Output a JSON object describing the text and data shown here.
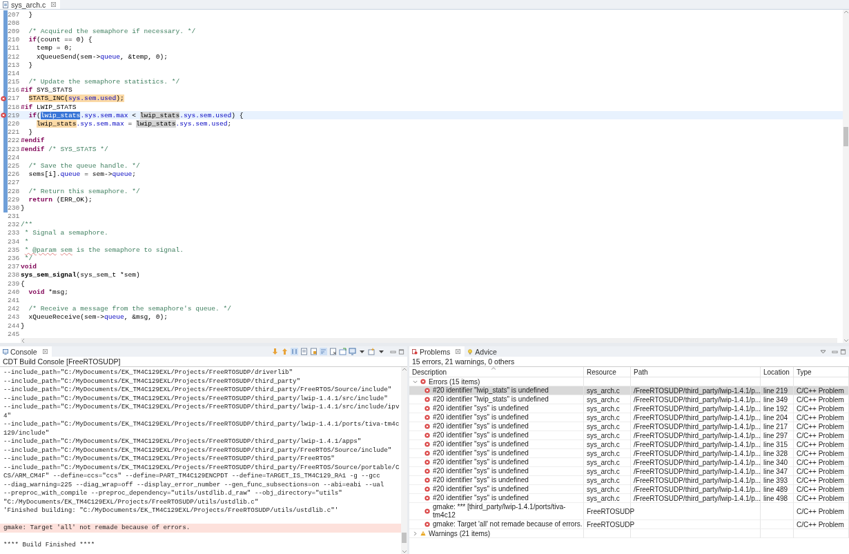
{
  "editor": {
    "tab": {
      "label": "sys_arch.c",
      "selected": true
    },
    "lines": [
      {
        "number": "207",
        "changed": true,
        "tokens": [
          {
            "kind": "plain",
            "text": "  }"
          }
        ]
      },
      {
        "number": "208",
        "changed": true
      },
      {
        "number": "209",
        "changed": true,
        "tokens": [
          {
            "kind": "comment",
            "text": "  /* Acquired the semaphore if necessary. */"
          }
        ]
      },
      {
        "number": "210",
        "changed": true,
        "tokens": [
          {
            "kind": "keyword",
            "text": "  if"
          },
          {
            "kind": "plain",
            "text": "(count == 0) {"
          }
        ]
      },
      {
        "number": "211",
        "changed": true,
        "tokens": [
          {
            "kind": "plain",
            "text": "    temp = 0;"
          }
        ]
      },
      {
        "number": "212",
        "changed": true,
        "tokens": [
          {
            "kind": "plain",
            "text": "    xQueueSend(sem->"
          },
          {
            "kind": "field",
            "text": "queue"
          },
          {
            "kind": "plain",
            "text": ", &temp, 0);"
          }
        ]
      },
      {
        "number": "213",
        "changed": true,
        "tokens": [
          {
            "kind": "plain",
            "text": "  }"
          }
        ]
      },
      {
        "number": "214",
        "changed": true
      },
      {
        "number": "215",
        "changed": true,
        "tokens": [
          {
            "kind": "comment",
            "text": "  /* Update the semaphore statistics. */"
          }
        ]
      },
      {
        "number": "216",
        "changed": true,
        "tokens": [
          {
            "kind": "directive",
            "text": "#if"
          },
          {
            "kind": "plain",
            "text": " SYS_STATS"
          }
        ]
      },
      {
        "number": "217",
        "changed": true,
        "error": true,
        "tokens": [
          {
            "kind": "plain",
            "text": "  STATS_INC(",
            "problem": true
          },
          {
            "kind": "field",
            "text": "sys.sem.used",
            "problem": true
          },
          {
            "kind": "plain",
            "text": ");",
            "problem": true
          }
        ]
      },
      {
        "number": "218",
        "changed": true,
        "tokens": [
          {
            "kind": "directive",
            "text": "#if"
          },
          {
            "kind": "plain",
            "text": " LWIP_STATS"
          }
        ]
      },
      {
        "number": "219",
        "changed": true,
        "error": true,
        "current": true,
        "tokens": [
          {
            "kind": "keyword",
            "text": "  if"
          },
          {
            "kind": "plain",
            "text": "("
          },
          {
            "kind": "plain",
            "text": "lwip_stats",
            "selected": true
          },
          {
            "kind": "field",
            "text": ".sys.sem.max"
          },
          {
            "kind": "plain",
            "text": " < "
          },
          {
            "kind": "plain",
            "text": "lwip_stats",
            "occurrence": true
          },
          {
            "kind": "field",
            "text": ".sys.sem.used"
          },
          {
            "kind": "plain",
            "text": ") {"
          }
        ]
      },
      {
        "number": "220",
        "changed": true,
        "tokens": [
          {
            "kind": "plain",
            "text": "    lwip_stats",
            "problem": true
          },
          {
            "kind": "field",
            "text": ".sys.sem.max"
          },
          {
            "kind": "plain",
            "text": " = "
          },
          {
            "kind": "plain",
            "text": "lwip_stats",
            "occurrence": true
          },
          {
            "kind": "field",
            "text": ".sys.sem.used"
          },
          {
            "kind": "plain",
            "text": ";"
          }
        ]
      },
      {
        "number": "221",
        "changed": true,
        "tokens": [
          {
            "kind": "plain",
            "text": "  }"
          }
        ]
      },
      {
        "number": "222",
        "changed": true,
        "tokens": [
          {
            "kind": "directive",
            "text": "#endif"
          }
        ]
      },
      {
        "number": "223",
        "changed": true,
        "tokens": [
          {
            "kind": "directive",
            "text": "#endif"
          },
          {
            "kind": "comment",
            "text": " /* SYS_STATS */"
          }
        ]
      },
      {
        "number": "224",
        "changed": true
      },
      {
        "number": "225",
        "changed": true,
        "tokens": [
          {
            "kind": "comment",
            "text": "  /* Save the queue handle. */"
          }
        ]
      },
      {
        "number": "226",
        "changed": true,
        "tokens": [
          {
            "kind": "plain",
            "text": "  sems[i]."
          },
          {
            "kind": "field",
            "text": "queue"
          },
          {
            "kind": "plain",
            "text": " = sem->"
          },
          {
            "kind": "field",
            "text": "queue"
          },
          {
            "kind": "plain",
            "text": ";"
          }
        ]
      },
      {
        "number": "227",
        "changed": true
      },
      {
        "number": "228",
        "changed": true,
        "tokens": [
          {
            "kind": "comment",
            "text": "  /* Return this semaphore. */"
          }
        ]
      },
      {
        "number": "229",
        "changed": true,
        "tokens": [
          {
            "kind": "keyword",
            "text": "  return"
          },
          {
            "kind": "plain",
            "text": " (ERR_OK);"
          }
        ]
      },
      {
        "number": "230",
        "changed": true,
        "tokens": [
          {
            "kind": "plain",
            "text": "}"
          }
        ]
      },
      {
        "number": "231",
        "changed": false
      },
      {
        "number": "232",
        "changed": false,
        "tokens": [
          {
            "kind": "comment",
            "text": "/**"
          }
        ]
      },
      {
        "number": "233",
        "changed": false,
        "tokens": [
          {
            "kind": "comment",
            "text": " * Signal a semaphore."
          }
        ]
      },
      {
        "number": "234",
        "changed": false,
        "tokens": [
          {
            "kind": "comment",
            "text": " *"
          }
        ]
      },
      {
        "number": "235",
        "changed": false,
        "tokens": [
          {
            "kind": "comment",
            "text": " * @param",
            "misspelled": true
          },
          {
            "kind": "comment",
            "text": " sem",
            "misspelled": true
          },
          {
            "kind": "comment",
            "text": " is the semaphore to signal."
          }
        ]
      },
      {
        "number": "236",
        "changed": false,
        "tokens": [
          {
            "kind": "comment",
            "text": " */"
          }
        ]
      },
      {
        "number": "237",
        "changed": false,
        "tokens": [
          {
            "kind": "keyword",
            "text": "void"
          }
        ]
      },
      {
        "number": "238",
        "changed": false,
        "tokens": [
          {
            "kind": "function",
            "text": "sys_sem_signal"
          },
          {
            "kind": "plain",
            "text": "(sys_sem_t *sem)"
          }
        ]
      },
      {
        "number": "239",
        "changed": false,
        "tokens": [
          {
            "kind": "plain",
            "text": "{"
          }
        ]
      },
      {
        "number": "240",
        "changed": false,
        "tokens": [
          {
            "kind": "keyword",
            "text": "  void"
          },
          {
            "kind": "plain",
            "text": " *msg;"
          }
        ]
      },
      {
        "number": "241",
        "changed": false
      },
      {
        "number": "242",
        "changed": false,
        "tokens": [
          {
            "kind": "comment",
            "text": "  /* Receive a message from the semaphore's queue. */"
          }
        ]
      },
      {
        "number": "243",
        "changed": false,
        "tokens": [
          {
            "kind": "plain",
            "text": "  xQueueReceive(sem->"
          },
          {
            "kind": "field",
            "text": "queue"
          },
          {
            "kind": "plain",
            "text": ", &msg, 0);"
          }
        ]
      },
      {
        "number": "244",
        "changed": false,
        "tokens": [
          {
            "kind": "plain",
            "text": "}"
          }
        ]
      },
      {
        "number": "245",
        "changed": false
      }
    ]
  },
  "console": {
    "tab": {
      "label": "Console",
      "selected": true
    },
    "subtitle": "CDT Build Console [FreeRTOSUDP]",
    "lines": [
      {
        "kind": "output",
        "text": "--include_path=\"C:/MyDocuments/EK_TM4C129EXL/Projects/FreeRTOSUDP/driverlib\""
      },
      {
        "kind": "output",
        "text": "--include_path=\"C:/MyDocuments/EK_TM4C129EXL/Projects/FreeRTOSUDP/third_party\""
      },
      {
        "kind": "output",
        "text": "--include_path=\"C:/MyDocuments/EK_TM4C129EXL/Projects/FreeRTOSUDP/third_party/FreeRTOS/Source/include\""
      },
      {
        "kind": "output",
        "text": "--include_path=\"C:/MyDocuments/EK_TM4C129EXL/Projects/FreeRTOSUDP/third_party/lwip-1.4.1/src/include\""
      },
      {
        "kind": "output",
        "text": "--include_path=\"C:/MyDocuments/EK_TM4C129EXL/Projects/FreeRTOSUDP/third_party/lwip-1.4.1/src/include/ipv"
      },
      {
        "kind": "output",
        "text": "4\""
      },
      {
        "kind": "output",
        "text": "--include_path=\"C:/MyDocuments/EK_TM4C129EXL/Projects/FreeRTOSUDP/third_party/lwip-1.4.1/ports/tiva-tm4c"
      },
      {
        "kind": "output",
        "text": "129/include\""
      },
      {
        "kind": "output",
        "text": "--include_path=\"C:/MyDocuments/EK_TM4C129EXL/Projects/FreeRTOSUDP/third_party/lwip-1.4.1/apps\""
      },
      {
        "kind": "output",
        "text": "--include_path=\"C:/MyDocuments/EK_TM4C129EXL/Projects/FreeRTOSUDP/third_party/FreeRTOS/Source/include\""
      },
      {
        "kind": "output",
        "text": "--include_path=\"C:/MyDocuments/EK_TM4C129EXL/Projects/FreeRTOSUDP/third_party/FreeRTOS\""
      },
      {
        "kind": "output",
        "text": "--include_path=\"C:/MyDocuments/EK_TM4C129EXL/Projects/FreeRTOSUDP/third_party/FreeRTOS/Source/portable/C"
      },
      {
        "kind": "output",
        "text": "CS/ARM_CM4F\" --define=ccs=\"ccs\" --define=PART_TM4C129ENCPDT --define=TARGET_IS_TM4C129_RA1 -g --gcc"
      },
      {
        "kind": "output",
        "text": "--diag_warning=225 --diag_wrap=off --display_error_number --gen_func_subsections=on --abi=eabi --ual"
      },
      {
        "kind": "output",
        "text": "--preproc_with_compile --preproc_dependency=\"utils/ustdlib.d_raw\" --obj_directory=\"utils\""
      },
      {
        "kind": "output",
        "text": "\"C:/MyDocuments/EK_TM4C129EXL/Projects/FreeRTOSUDP/utils/ustdlib.c\""
      },
      {
        "kind": "output",
        "text": "'Finished building: \"C:/MyDocuments/EK_TM4C129EXL/Projects/FreeRTOSUDP/utils/ustdlib.c\"'"
      },
      {
        "kind": "error",
        "gap_before": true,
        "text": "gmake: Target 'all' not remade because of errors."
      },
      {
        "kind": "output",
        "gap_before": true,
        "text": "**** Build Finished ****"
      }
    ]
  },
  "problems": {
    "tabs": [
      {
        "label": "Problems",
        "selected": true
      },
      {
        "label": "Advice",
        "selected": false
      }
    ],
    "summary": "15 errors, 21 warnings, 0 others",
    "columns": [
      "Description",
      "Resource",
      "Path",
      "Location",
      "Type"
    ],
    "groups": [
      {
        "kind": "error",
        "label": "Errors (15 items)",
        "expanded": true,
        "items": [
          {
            "description": "#20 identifier \"lwip_stats\" is undefined",
            "resource": "sys_arch.c",
            "path": "/FreeRTOSUDP/third_party/lwip-1.4.1/p...",
            "location": "line 219",
            "type": "C/C++ Problem",
            "selected": true
          },
          {
            "description": "#20 identifier \"lwip_stats\" is undefined",
            "resource": "sys_arch.c",
            "path": "/FreeRTOSUDP/third_party/lwip-1.4.1/p...",
            "location": "line 349",
            "type": "C/C++ Problem",
            "selected": false
          },
          {
            "description": "#20 identifier \"sys\" is undefined",
            "resource": "sys_arch.c",
            "path": "/FreeRTOSUDP/third_party/lwip-1.4.1/p...",
            "location": "line 192",
            "type": "C/C++ Problem",
            "selected": false
          },
          {
            "description": "#20 identifier \"sys\" is undefined",
            "resource": "sys_arch.c",
            "path": "/FreeRTOSUDP/third_party/lwip-1.4.1/p...",
            "location": "line 204",
            "type": "C/C++ Problem",
            "selected": false
          },
          {
            "description": "#20 identifier \"sys\" is undefined",
            "resource": "sys_arch.c",
            "path": "/FreeRTOSUDP/third_party/lwip-1.4.1/p...",
            "location": "line 217",
            "type": "C/C++ Problem",
            "selected": false
          },
          {
            "description": "#20 identifier \"sys\" is undefined",
            "resource": "sys_arch.c",
            "path": "/FreeRTOSUDP/third_party/lwip-1.4.1/p...",
            "location": "line 297",
            "type": "C/C++ Problem",
            "selected": false
          },
          {
            "description": "#20 identifier \"sys\" is undefined",
            "resource": "sys_arch.c",
            "path": "/FreeRTOSUDP/third_party/lwip-1.4.1/p...",
            "location": "line 315",
            "type": "C/C++ Problem",
            "selected": false
          },
          {
            "description": "#20 identifier \"sys\" is undefined",
            "resource": "sys_arch.c",
            "path": "/FreeRTOSUDP/third_party/lwip-1.4.1/p...",
            "location": "line 328",
            "type": "C/C++ Problem",
            "selected": false
          },
          {
            "description": "#20 identifier \"sys\" is undefined",
            "resource": "sys_arch.c",
            "path": "/FreeRTOSUDP/third_party/lwip-1.4.1/p...",
            "location": "line 340",
            "type": "C/C++ Problem",
            "selected": false
          },
          {
            "description": "#20 identifier \"sys\" is undefined",
            "resource": "sys_arch.c",
            "path": "/FreeRTOSUDP/third_party/lwip-1.4.1/p...",
            "location": "line 347",
            "type": "C/C++ Problem",
            "selected": false
          },
          {
            "description": "#20 identifier \"sys\" is undefined",
            "resource": "sys_arch.c",
            "path": "/FreeRTOSUDP/third_party/lwip-1.4.1/p...",
            "location": "line 393",
            "type": "C/C++ Problem",
            "selected": false
          },
          {
            "description": "#20 identifier \"sys\" is undefined",
            "resource": "sys_arch.c",
            "path": "/FreeRTOSUDP/third_party/lwip-1.4.1/p...",
            "location": "line 489",
            "type": "C/C++ Problem",
            "selected": false
          },
          {
            "description": "#20 identifier \"sys\" is undefined",
            "resource": "sys_arch.c",
            "path": "/FreeRTOSUDP/third_party/lwip-1.4.1/p...",
            "location": "line 498",
            "type": "C/C++ Problem",
            "selected": false
          },
          {
            "description": "gmake: *** [third_party/lwip-1.4.1/ports/tiva-tm4c12",
            "resource": "FreeRTOSUDP",
            "type": "C/C++ Problem",
            "selected": false
          },
          {
            "description": "gmake: Target 'all' not remade because of errors.",
            "resource": "FreeRTOSUDP",
            "type": "C/C++ Problem",
            "selected": false
          }
        ]
      },
      {
        "kind": "warning",
        "label": "Warnings (21 items)",
        "expanded": false
      }
    ]
  }
}
